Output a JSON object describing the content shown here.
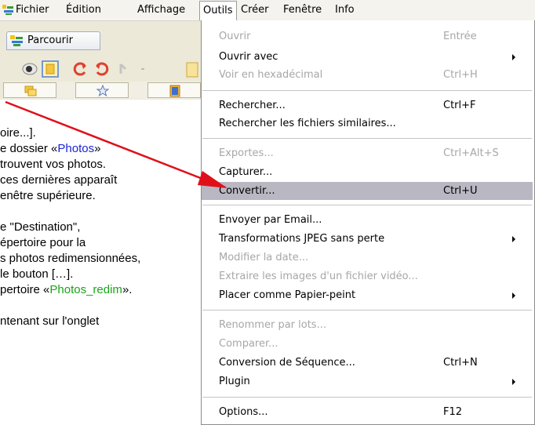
{
  "menubar": {
    "items": [
      "Fichier",
      "Édition",
      "Affichage",
      "Outils",
      "Créer",
      "Fenêtre",
      "Info"
    ]
  },
  "browser": {
    "tab_label": "Parcourir"
  },
  "tutorial": {
    "lines": [
      "oire...].",
      "e dossier «",
      "Photos",
      "»",
      "trouvent vos photos.",
      "ces dernières apparaît",
      "enêtre supérieure.",
      "e \"Destination\",",
      "épertoire pour la",
      "s photos redimensionnées,",
      "le bouton […].",
      "pertoire «",
      "Photos_redim",
      "».",
      "ntenant sur l'onglet"
    ]
  },
  "menu": {
    "items": [
      {
        "label": "Ouvrir",
        "shortcut": "Entrée",
        "disabled": true
      },
      {
        "label": "Ouvrir avec",
        "submenu": true
      },
      {
        "label": "Voir en hexadécimal",
        "shortcut": "Ctrl+H",
        "disabled": true
      },
      {
        "label": "Rechercher...",
        "shortcut": "Ctrl+F"
      },
      {
        "label": "Rechercher les fichiers similaires..."
      },
      {
        "label": "Exportes...",
        "shortcut": "Ctrl+Alt+S",
        "disabled": true
      },
      {
        "label": "Capturer..."
      },
      {
        "label": "Convertir...",
        "shortcut": "Ctrl+U",
        "highlighted": true
      },
      {
        "label": "Envoyer par Email..."
      },
      {
        "label": "Transformations JPEG sans perte",
        "submenu": true
      },
      {
        "label": "Modifier la date...",
        "disabled": true
      },
      {
        "label": "Extraire les images d'un fichier vidéo...",
        "disabled": true
      },
      {
        "label": "Placer comme Papier-peint",
        "submenu": true
      },
      {
        "label": "Renommer par lots...",
        "disabled": true
      },
      {
        "label": "Comparer...",
        "disabled": true
      },
      {
        "label": "Conversion de Séquence...",
        "shortcut": "Ctrl+N"
      },
      {
        "label": "Plugin",
        "submenu": true
      },
      {
        "label": "Options...",
        "shortcut": "F12"
      }
    ]
  },
  "colors": {
    "highlight": "#b8b7c2",
    "disabled_text": "#a7a6aa",
    "arrow": "#e0101a",
    "link_blue": "#1a24d6",
    "link_green": "#19a615"
  }
}
